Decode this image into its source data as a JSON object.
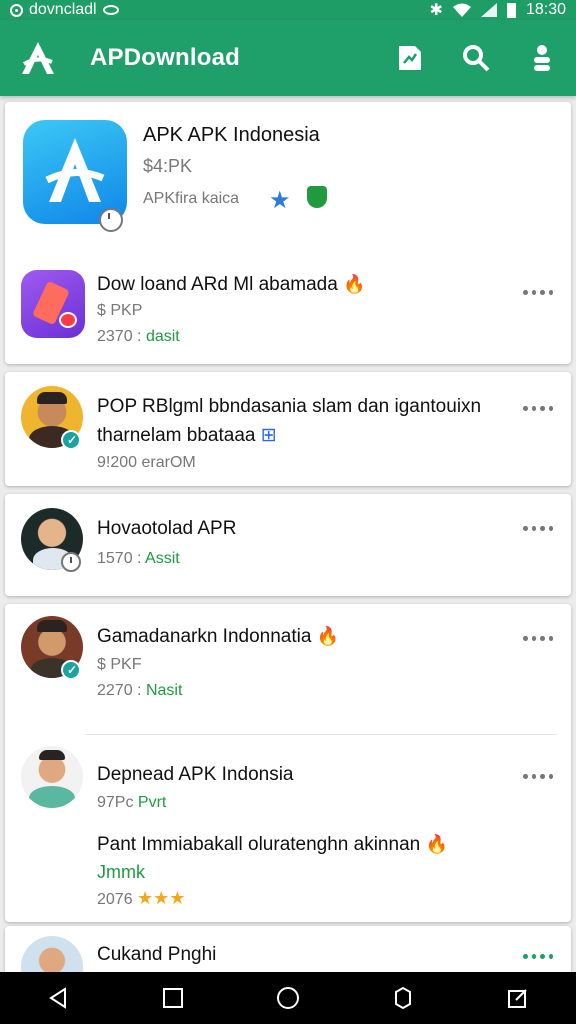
{
  "status_bar": {
    "label": "dovncladl",
    "time": "18:30"
  },
  "app_bar": {
    "title": "APDownload"
  },
  "featured": {
    "title": "APK APK Indonesia",
    "subtitle": "$4:PK",
    "meta": "APKfira kaica"
  },
  "items": [
    {
      "name": "Dow loand ARd Ml abamada",
      "meta_prefix": "$ PKP",
      "stat": "2370 :",
      "stat_green": "dasit"
    },
    {
      "name": "POP RBlgml bbndasania slam dan igantouixn",
      "line2": "tharnelam bbataaa",
      "meta_prefix": "9!200 erarOM"
    },
    {
      "name": "Hovaotolad APR",
      "stat": "1570 :",
      "stat_green": "Assit"
    },
    {
      "name": "Gamadanarkn Indonnatia",
      "meta_prefix": "$ PKF",
      "stat": "2270 :",
      "stat_green": "Nasit"
    },
    {
      "name": "Depnead APK Indonsia",
      "stat": "97Pc",
      "stat_green": "Pvrt",
      "extra_line": "Pant Immiabakall oluratenghn akinnan",
      "extra_green": "Jmmk",
      "rating_text": "2076"
    },
    {
      "name": "Cukand Pnghi"
    }
  ]
}
